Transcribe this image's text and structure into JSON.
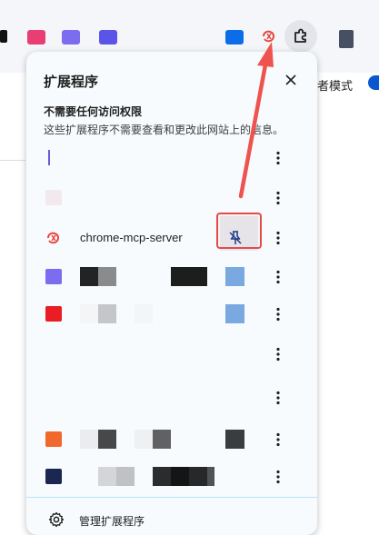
{
  "toolbar": {
    "icons": [
      {
        "name": "toolbar-icon-1",
        "color": "#e83e73"
      },
      {
        "name": "toolbar-icon-2",
        "color": "#7b6cf0"
      },
      {
        "name": "toolbar-icon-3",
        "color": "#5a55e8"
      },
      {
        "name": "toolbar-icon-4",
        "color": "#0b6ee8"
      },
      {
        "name": "toolbar-icon-5",
        "color": "#e8443e"
      }
    ],
    "accent_active_button": "#e3e5ea"
  },
  "background": {
    "partial_label": "者模式",
    "toggle_color": "#0b57d0"
  },
  "popup": {
    "title": "扩展程序",
    "close_icon": "close-icon",
    "section_title": "不需要任何访问权限",
    "section_desc": "这些扩展程序不需要查看和更改此网站上的信息。",
    "extensions": [
      {
        "name": "",
        "icon_color": "#6a5bd9"
      },
      {
        "name": "",
        "icon_color": "#f1e9ee"
      },
      {
        "name": "chrome-mcp-server",
        "icon_color": "#e8443e"
      },
      {
        "name": "",
        "icon_color": "#7b6cf0"
      },
      {
        "name": "",
        "icon_color": "#ea1c24"
      },
      {
        "name": "",
        "icon_color": "#f8fbfd"
      },
      {
        "name": "",
        "icon_color": "#f0682c"
      },
      {
        "name": "",
        "icon_color": "#1a2750"
      }
    ],
    "manage_label": "管理扩展程序"
  },
  "annotation": {
    "highlight_color": "#e34b4b"
  }
}
